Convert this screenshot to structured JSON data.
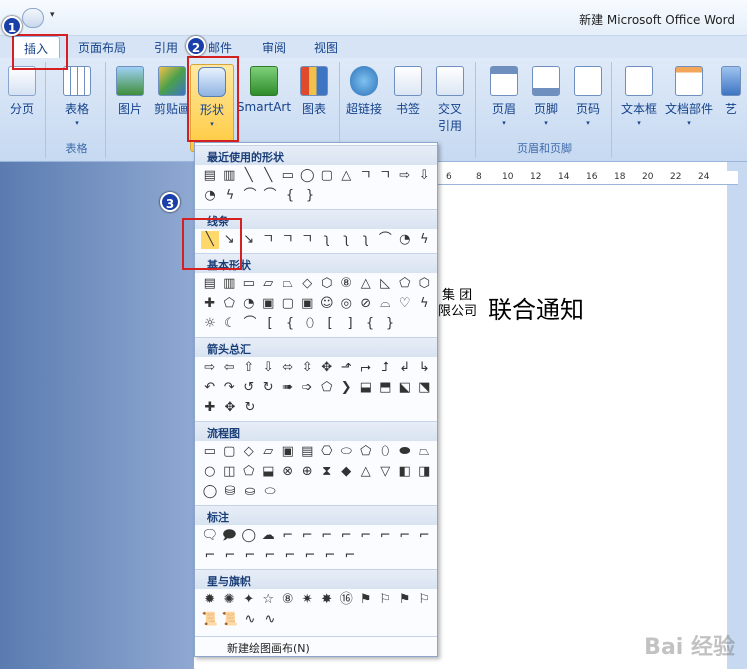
{
  "window": {
    "title": "新建 Microsoft Office Word"
  },
  "qat": {
    "arrow": "▾"
  },
  "tabs": [
    {
      "label": "插入",
      "active": true
    },
    {
      "label": "页面布局"
    },
    {
      "label": "引用"
    },
    {
      "label": "邮件"
    },
    {
      "label": "审阅"
    },
    {
      "label": "视图"
    }
  ],
  "ribbon": {
    "pagebreak": "分页",
    "table": "表格",
    "table_group": "表格",
    "picture": "图片",
    "clipart": "剪贴画",
    "shapes": "形状",
    "smartart": "SmartArt",
    "chart": "图表",
    "hyperlink": "超链接",
    "bookmark": "书签",
    "crossref_1": "交叉",
    "crossref_2": "引用",
    "header": "页眉",
    "footer": "页脚",
    "pagenum": "页码",
    "hf_group": "页眉和页脚",
    "textbox": "文本框",
    "docparts": "文档部件",
    "art": "艺",
    "dropdown": "▾"
  },
  "ruler": [
    "6",
    "8",
    "10",
    "12",
    "14",
    "16",
    "18",
    "20",
    "22",
    "24"
  ],
  "document": {
    "logo_line1": "集 团",
    "logo_line2": "限公司",
    "heading": "联合通知"
  },
  "menu": {
    "sections": {
      "recent": "最近使用的形状",
      "lines": "线条",
      "basic": "基本形状",
      "arrows": "箭头总汇",
      "flowchart": "流程图",
      "callouts": "标注",
      "stars": "星与旗帜"
    },
    "new_canvas": "新建绘图画布(N)"
  },
  "annotations": {
    "b1": "1",
    "b2": "2",
    "b3": "3"
  },
  "watermark": "Bai 经验"
}
